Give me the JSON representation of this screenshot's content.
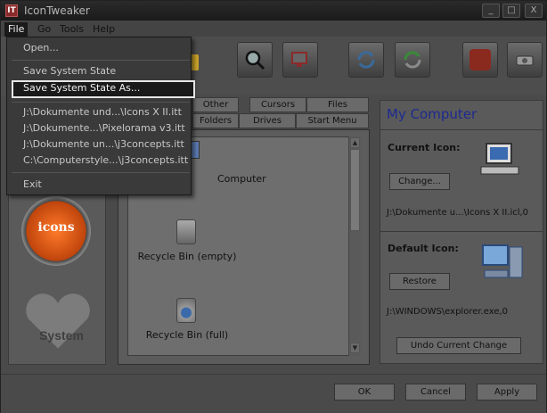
{
  "window": {
    "title": "IconTweaker",
    "app_icon": "IT"
  },
  "titlebar_buttons": [
    "_",
    "□",
    "X"
  ],
  "menu": [
    "File",
    "Go",
    "Tools",
    "Help"
  ],
  "file_menu": {
    "items": [
      "Open...",
      "Save System State",
      "Save System State As...",
      "J:\\Dokumente und...\\Icons X II.itt",
      "J:\\Dokumente...\\Pixelorama v3.itt",
      "J:\\Dokumente un...\\j3concepts.itt",
      "C:\\Computerstyle...\\j3concepts.itt",
      "Exit"
    ],
    "selected": "Save System State As..."
  },
  "toolbar_icons": [
    "warning-icon",
    "magnifier-icon",
    "monitor-icon",
    "refresh-blue-icon",
    "refresh-green-icon",
    "folder-icon",
    "drive-icon"
  ],
  "tabs_row1": [
    "Other",
    "Cursors",
    "Files"
  ],
  "tabs_row2": [
    "Folders",
    "Drives",
    "Start Menu"
  ],
  "list": {
    "items": [
      "Computer",
      "Recycle Bin (empty)",
      "Recycle Bin (full)"
    ]
  },
  "right_panel": {
    "title": "My Computer",
    "current_icon_label": "Current Icon:",
    "change_button": "Change...",
    "current_path": "J:\\Dokumente u...\\Icons X II.icl,0",
    "default_icon_label": "Default Icon:",
    "restore_button": "Restore",
    "default_path": "J:\\WINDOWS\\explorer.exe,0",
    "undo_button": "Undo Current Change"
  },
  "left_rail": {
    "badge_text": "icons",
    "heart_text": "System"
  },
  "bottom_buttons": {
    "ok": "OK",
    "cancel": "Cancel",
    "apply": "Apply"
  },
  "colors": {
    "accent_title": "#1c2a8e",
    "badge_orange": "#e0601a"
  }
}
